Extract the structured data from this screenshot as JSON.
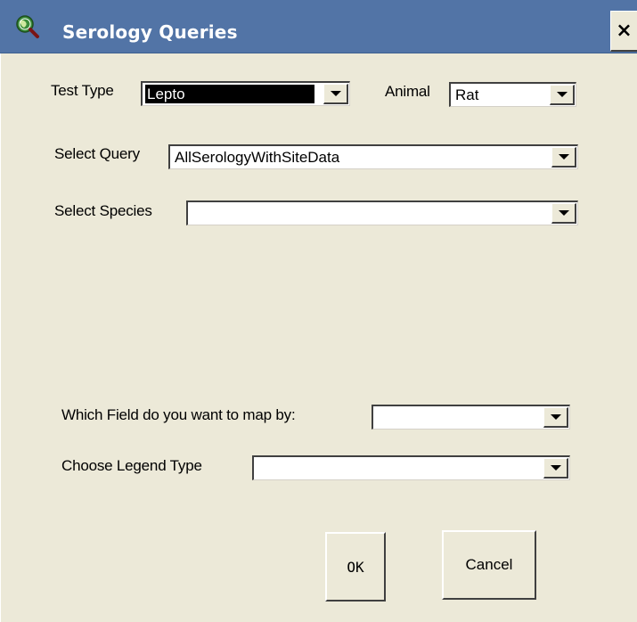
{
  "window": {
    "title": "Serology Queries",
    "icon": "search-globe-icon",
    "close_glyph": "×"
  },
  "colors": {
    "titlebar": "#5274a6",
    "face": "#ece9d8",
    "selection": "#000000"
  },
  "form": {
    "test_type": {
      "label": "Test Type",
      "value": "Lepto"
    },
    "animal": {
      "label": "Animal",
      "value": "Rat"
    },
    "select_query": {
      "label": "Select Query",
      "value": "AllSerologyWithSiteData"
    },
    "select_species": {
      "label": "Select Species",
      "value": ""
    },
    "map_field": {
      "label": "Which Field do you want to map by:",
      "value": ""
    },
    "legend_type": {
      "label": "Choose Legend Type",
      "value": ""
    }
  },
  "buttons": {
    "ok": "OK",
    "cancel": "Cancel"
  }
}
